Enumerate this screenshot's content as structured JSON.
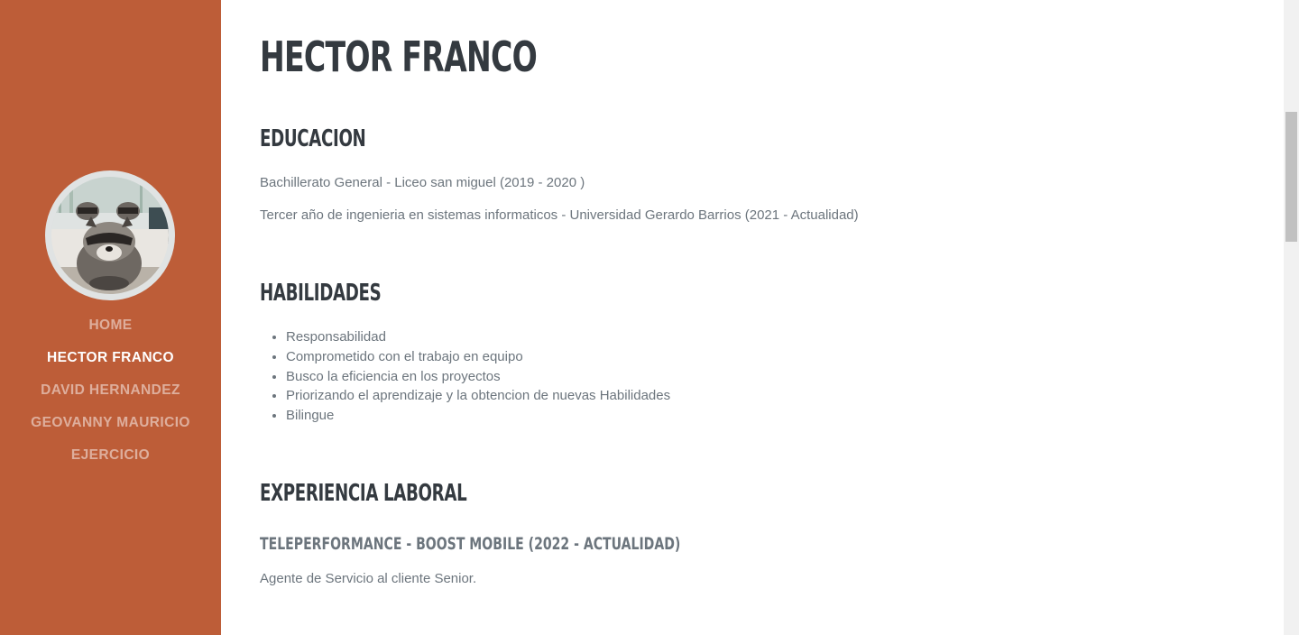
{
  "sidebar": {
    "background": "#bd5d38",
    "avatar_icon": "raccoon-photo",
    "nav": [
      {
        "label": "Home",
        "active": false
      },
      {
        "label": "Hector Franco",
        "active": true
      },
      {
        "label": "David Hernandez",
        "active": false
      },
      {
        "label": "Geovanny Mauricio",
        "active": false
      },
      {
        "label": "Ejercicio",
        "active": false
      }
    ]
  },
  "main": {
    "name": "Hector Franco",
    "education": {
      "heading": "Educacion",
      "items": [
        "Bachillerato General - Liceo san miguel (2019 - 2020 )",
        "Tercer año de ingenieria en sistemas informaticos - Universidad Gerardo Barrios (2021 - Actualidad)"
      ]
    },
    "skills": {
      "heading": "Habilidades",
      "items": [
        "Responsabilidad",
        "Comprometido con el trabajo en equipo",
        "Busco la eficiencia en los proyectos",
        "Priorizando el aprendizaje y la obtencion de nuevas Habilidades",
        "Bilingue"
      ]
    },
    "experience": {
      "heading": "Experiencia Laboral",
      "job_title": "Teleperformance - Boost Mobile (2022 - Actualidad)",
      "job_description": "Agente de Servicio al cliente Senior."
    }
  },
  "colors": {
    "heading": "#343a40",
    "text": "#6c757d",
    "accent": "#bd5d38"
  }
}
